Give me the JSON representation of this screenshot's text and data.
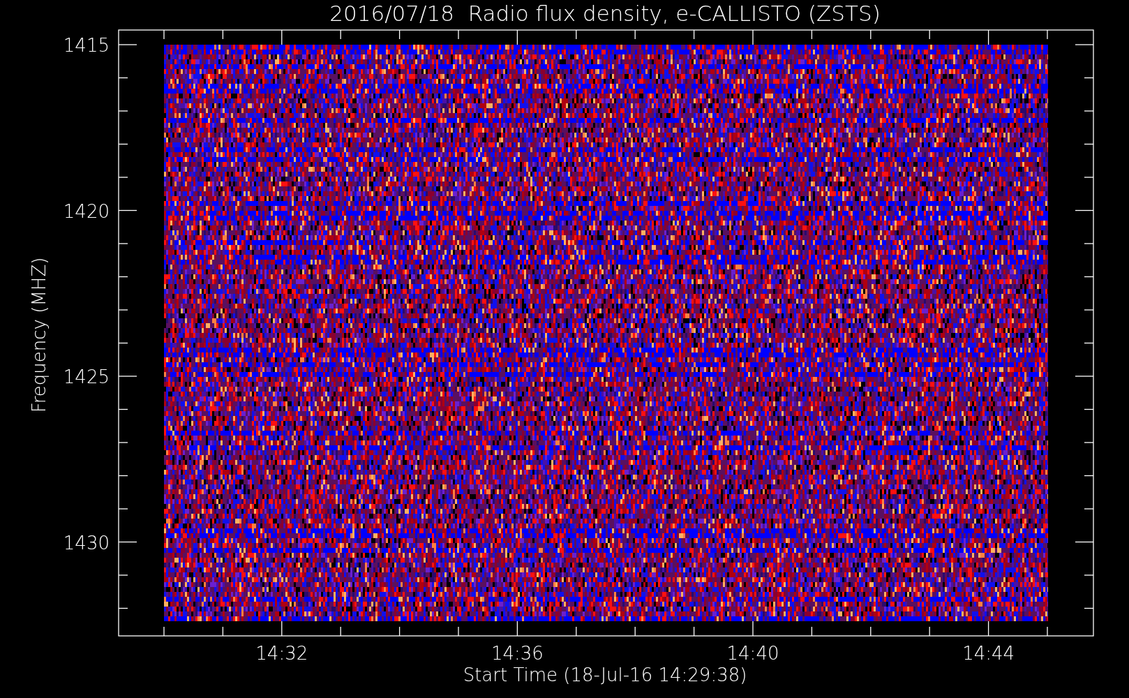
{
  "title": "2016/07/18  Radio flux density, e-CALLISTO (ZSTS)",
  "y_axis": {
    "label": "Frequency (MHZ)",
    "ticks": [
      "1415",
      "1420",
      "1425",
      "1430"
    ]
  },
  "x_axis": {
    "label": "Start Time (18-Jul-16 14:29:38)",
    "ticks": [
      "14:32",
      "14:36",
      "14:40",
      "14:44"
    ]
  }
}
